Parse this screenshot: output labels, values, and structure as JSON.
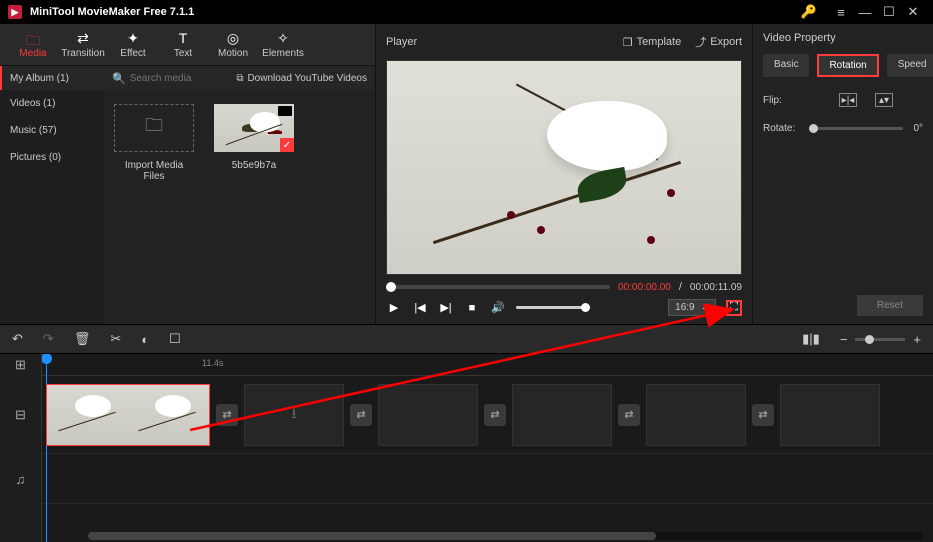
{
  "app": {
    "title": "MiniTool MovieMaker Free 7.1.1"
  },
  "toolbar": {
    "media": "Media",
    "transition": "Transition",
    "effect": "Effect",
    "text": "Text",
    "motion": "Motion",
    "elements": "Elements"
  },
  "sidebar": {
    "album": "My Album (1)",
    "videos": "Videos (1)",
    "music": "Music (57)",
    "pictures": "Pictures (0)"
  },
  "mediagrid": {
    "search_placeholder": "Search media",
    "download": "Download YouTube Videos",
    "import_label": "Import Media Files",
    "clip1_name": "5b5e9b7a"
  },
  "player": {
    "label": "Player",
    "template": "Template",
    "export": "Export",
    "current_time": "00:00:00.00",
    "sep": " / ",
    "total_time": "00:00:11.09",
    "ratio": "16:9"
  },
  "props": {
    "header": "Video Property",
    "tab_basic": "Basic",
    "tab_rotation": "Rotation",
    "tab_speed": "Speed",
    "flip": "Flip:",
    "rotate": "Rotate:",
    "rotate_value": "0°",
    "reset": "Reset"
  },
  "timeline": {
    "time_label": "11.4s"
  }
}
